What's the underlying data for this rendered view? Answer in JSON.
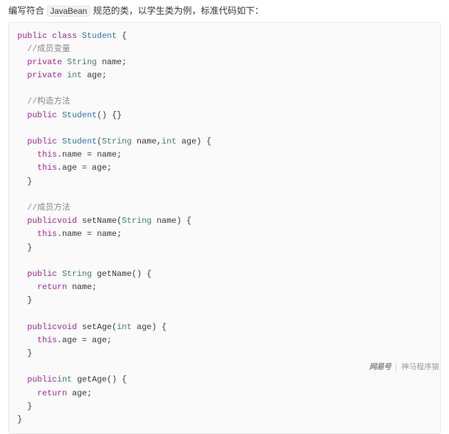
{
  "intro": {
    "prefix": "编写符合",
    "badge": "JavaBean",
    "suffix": "规范的类，以学生类为例，标准代码如下："
  },
  "code": {
    "kw_public": "public",
    "kw_class": "class",
    "kw_private": "private",
    "kw_return": "return",
    "kw_this": "this",
    "kw_void": "void",
    "t_string": "String",
    "t_int": "int",
    "cls_student": "Student",
    "cmt_fields": "//成员变量",
    "cmt_ctor": "//构造方法",
    "cmt_methods": "//成员方法",
    "id_name": "name",
    "id_age": "age",
    "m_setName": "setName",
    "m_getName": "getName",
    "m_setAge": "setAge",
    "m_getAge": "getAge"
  },
  "footer": {
    "brand": "网易号",
    "sep": "|",
    "author": "神马程序猿"
  }
}
